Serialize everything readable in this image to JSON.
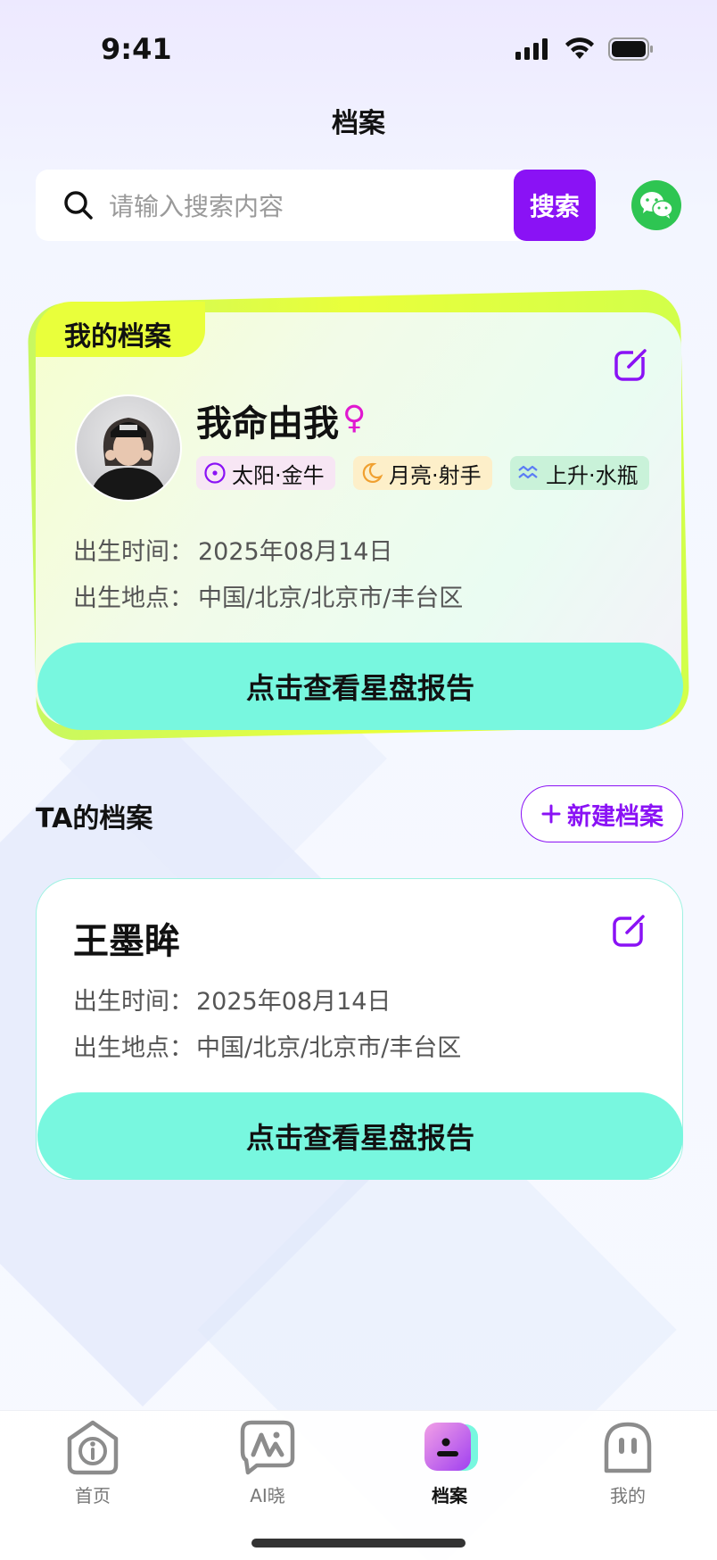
{
  "status_bar": {
    "time": "9:41"
  },
  "header": {
    "title": "档案"
  },
  "search": {
    "placeholder": "请输入搜索内容",
    "button_label": "搜索"
  },
  "my_profile": {
    "tab_label": "我的档案",
    "name": "我命由我",
    "gender_symbol": "♀",
    "tags": [
      {
        "label": "太阳·金牛",
        "icon": "sun-icon",
        "bg": "#f7e6f4",
        "color": "#8a12f5"
      },
      {
        "label": "月亮·射手",
        "icon": "moon-icon",
        "bg": "#fdefc9",
        "color": "#f0a030"
      },
      {
        "label": "上升·水瓶",
        "icon": "aquarius-icon",
        "bg": "#c9f2d9",
        "color": "#5b7cf5"
      }
    ],
    "birth_time_label": "出生时间：",
    "birth_time_value": "2025年08月14日",
    "birth_place_label": "出生地点：",
    "birth_place_value": "中国/北京/北京市/丰台区",
    "cta_label": "点击查看星盘报告"
  },
  "ta_section": {
    "title": "TA的档案",
    "new_button_label": "新建档案",
    "profiles": [
      {
        "name": "王墨眸",
        "birth_time_label": "出生时间：",
        "birth_time_value": "2025年08月14日",
        "birth_place_label": "出生地点：",
        "birth_place_value": "中国/北京/北京市/丰台区",
        "cta_label": "点击查看星盘报告"
      }
    ]
  },
  "tab_bar": {
    "items": [
      {
        "label": "首页",
        "icon": "info-icon",
        "active": false
      },
      {
        "label": "AI晓",
        "icon": "ai-icon",
        "active": false
      },
      {
        "label": "档案",
        "icon": "profile-icon",
        "active": true
      },
      {
        "label": "我的",
        "icon": "ghost-icon",
        "active": false
      }
    ]
  },
  "colors": {
    "accent": "#8a12f5",
    "cta": "#78f7df",
    "lime": "#e9ff3b",
    "wechat": "#2ec552"
  }
}
